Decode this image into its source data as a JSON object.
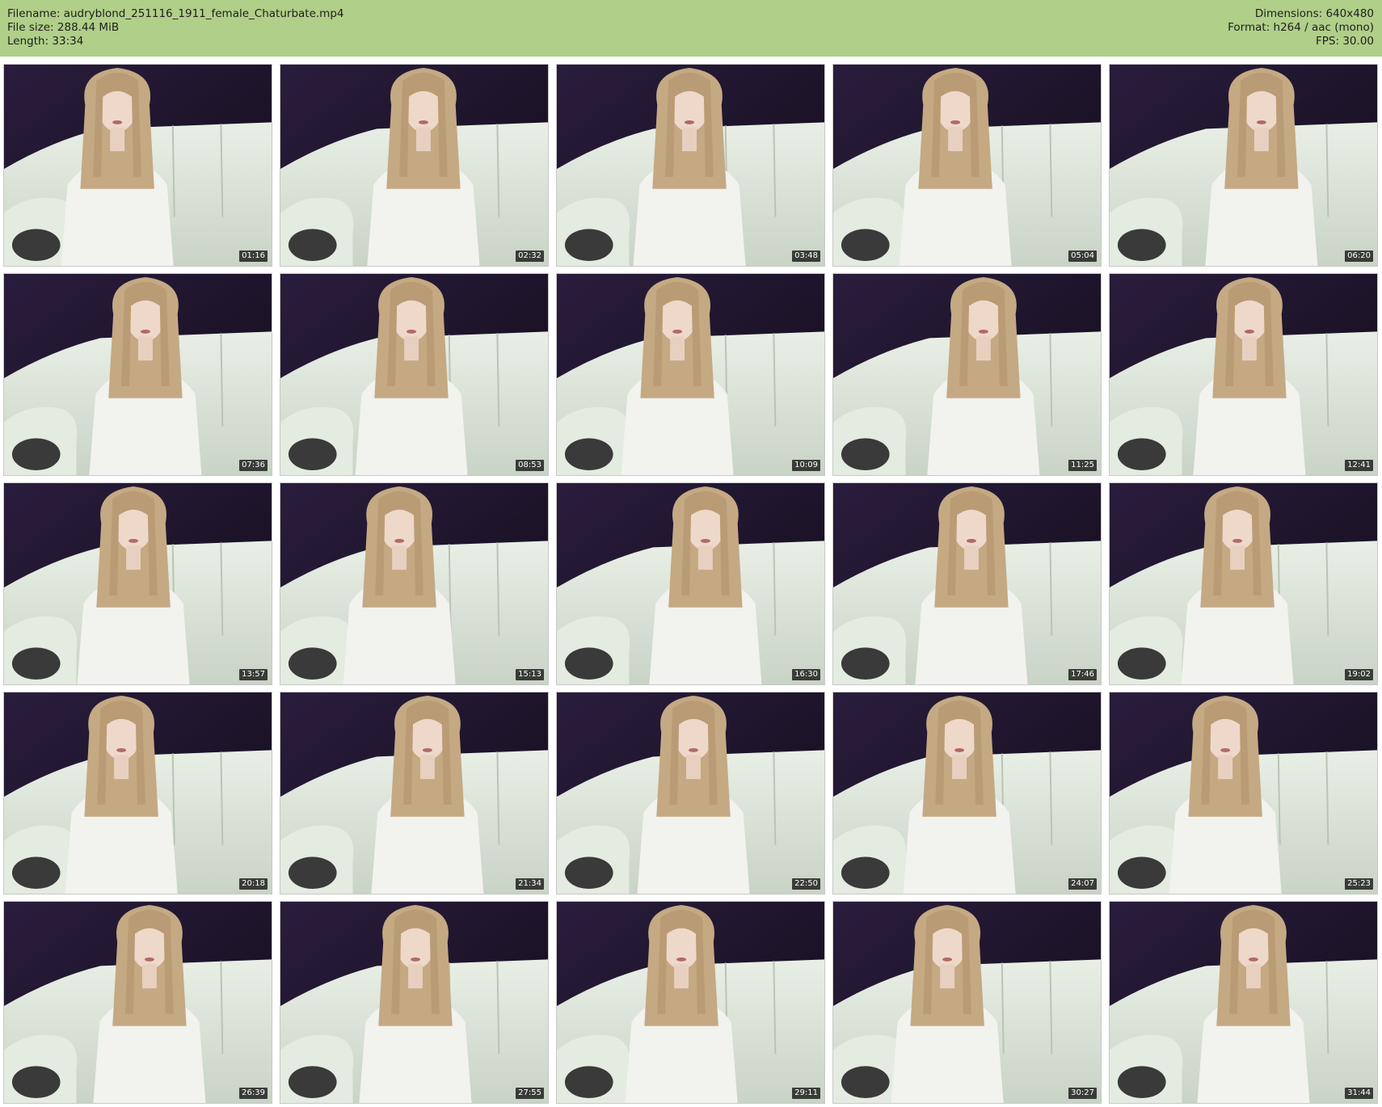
{
  "header": {
    "filename": "Filename: audryblond_251116_1911_female_Chaturbate.mp4",
    "filesize": "File size: 288.44 MiB",
    "length": "Length: 33:34",
    "dimensions": "Dimensions: 640x480",
    "format": "Format: h264 / aac (mono)",
    "fps": "FPS: 30.00"
  },
  "colors": {
    "header_bg": "#b0cf88",
    "backdrop": "#1a1224",
    "sofa": "#dfe8dc",
    "hair": "#c4a983",
    "shirt": "#f2f2ee"
  },
  "thumbnails": [
    "01:16",
    "02:32",
    "03:48",
    "05:04",
    "06:20",
    "07:36",
    "08:53",
    "10:09",
    "11:25",
    "12:41",
    "13:57",
    "15:13",
    "16:30",
    "17:46",
    "19:02",
    "20:18",
    "21:34",
    "22:50",
    "24:07",
    "25:23",
    "26:39",
    "27:55",
    "29:11",
    "30:27",
    "31:44"
  ]
}
